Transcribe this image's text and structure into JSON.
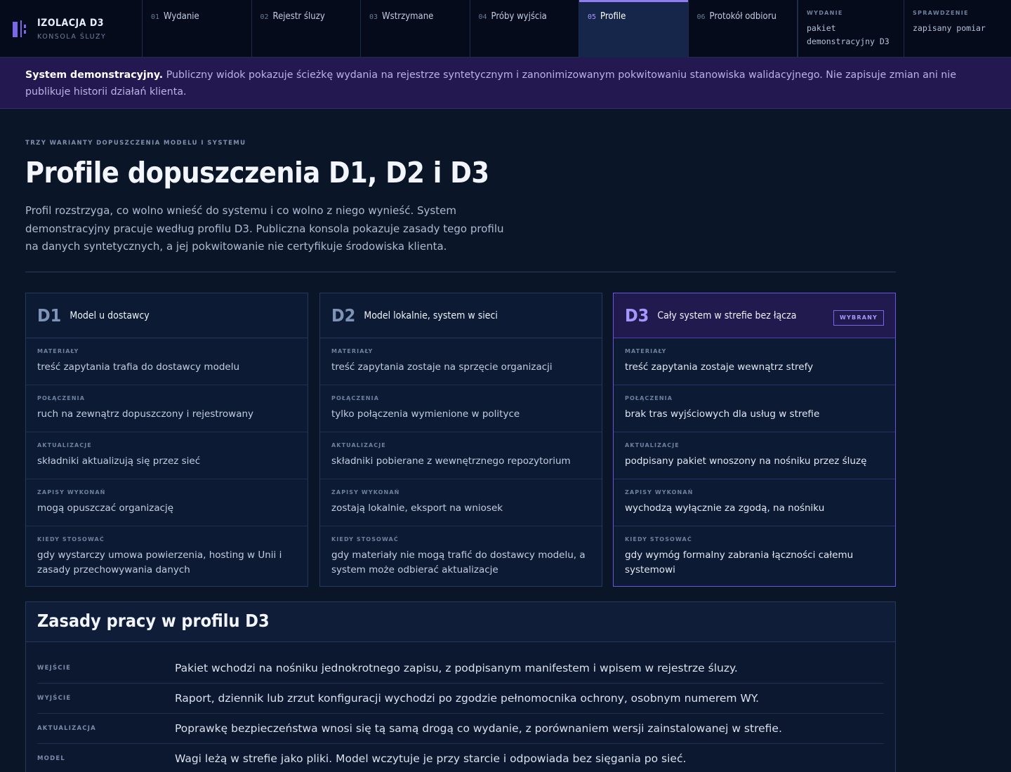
{
  "brand": {
    "title": "IZOLACJA D3",
    "subtitle": "KONSOLA ŚLUZY"
  },
  "nav": [
    {
      "num": "01",
      "label": "Wydanie"
    },
    {
      "num": "02",
      "label": "Rejestr śluzy"
    },
    {
      "num": "03",
      "label": "Wstrzymane"
    },
    {
      "num": "04",
      "label": "Próby wyjścia"
    },
    {
      "num": "05",
      "label": "Profile"
    },
    {
      "num": "06",
      "label": "Protokół odbioru"
    }
  ],
  "meta": {
    "release_label": "WYDANIE",
    "release_line1": "pakiet",
    "release_line2": "demonstracyjny D3",
    "check_label": "SPRAWDZENIE",
    "check_value": "zapisany pomiar"
  },
  "banner": {
    "strong": "System demonstracyjny.",
    "text": " Publiczny widok pokazuje ścieżkę wydania na rejestrze syntetycznym i zanonimizowanym pokwitowaniu stanowiska walidacyjnego. Nie zapisuje zmian ani nie publikuje historii działań klienta."
  },
  "eyebrow": "TRZY WARIANTY DOPUSZCZENIA MODELU I SYSTEMU",
  "title": "Profile dopuszczenia D1, D2 i D3",
  "intro": "Profil rozstrzyga, co wolno wnieść do systemu i co wolno z niego wynieść. System demonstracyjny pracuje według profilu D3. Publiczna konsola pokazuje zasady tego profilu na danych syntetycznych, a jej pokwitowanie nie certyfikuje środowiska klienta.",
  "row_labels": {
    "materials": "MATERIAŁY",
    "connections": "POŁĄCZENIA",
    "updates": "AKTUALIZACJE",
    "records": "ZAPISY WYKONAŃ",
    "when": "KIEDY STOSOWAĆ"
  },
  "cards": [
    {
      "code": "D1",
      "name": "Model u dostawcy",
      "materials": "treść zapytania trafia do dostawcy modelu",
      "connections": "ruch na zewnątrz dopuszczony i rejestrowany",
      "updates": "składniki aktualizują się przez sieć",
      "records": "mogą opuszczać organizację",
      "when": "gdy wystarczy umowa powierzenia, hosting w Unii i zasady przechowywania danych"
    },
    {
      "code": "D2",
      "name": "Model lokalnie, system w sieci",
      "materials": "treść zapytania zostaje na sprzęcie organizacji",
      "connections": "tylko połączenia wymienione w polityce",
      "updates": "składniki pobierane z wewnętrznego repozytorium",
      "records": "zostają lokalnie, eksport na wniosek",
      "when": "gdy materiały nie mogą trafić do dostawcy modelu, a system może odbierać aktualizacje"
    },
    {
      "code": "D3",
      "name": "Cały system w strefie bez łącza",
      "badge": "WYBRANY",
      "materials": "treść zapytania zostaje wewnątrz strefy",
      "connections": "brak tras wyjściowych dla usług w strefie",
      "updates": "podpisany pakiet wnoszony na nośniku przez śluzę",
      "records": "wychodzą wyłącznie za zgodą, na nośniku",
      "when": "gdy wymóg formalny zabrania łączności całemu systemowi"
    }
  ],
  "rules": {
    "title": "Zasady pracy w profilu D3",
    "items": [
      {
        "key": "WEJŚCIE",
        "value": "Pakiet wchodzi na nośniku jednokrotnego zapisu, z podpisanym manifestem i wpisem w rejestrze śluzy."
      },
      {
        "key": "WYJŚCIE",
        "value": "Raport, dziennik lub zrzut konfiguracji wychodzi po zgodzie pełnomocnika ochrony, osobnym numerem WY."
      },
      {
        "key": "AKTUALIZACJA",
        "value": "Poprawkę bezpieczeństwa wnosi się tą samą drogą co wydanie, z porównaniem wersji zainstalowanej w strefie."
      },
      {
        "key": "MODEL",
        "value": "Wagi leżą w strefie jako pliki. Model wczytuje je przy starcie i odpowiada bez sięgania po sieć."
      }
    ]
  },
  "colors": {
    "accent": "#8e7cf0",
    "background": "#0a1628",
    "banner": "#23184f"
  }
}
